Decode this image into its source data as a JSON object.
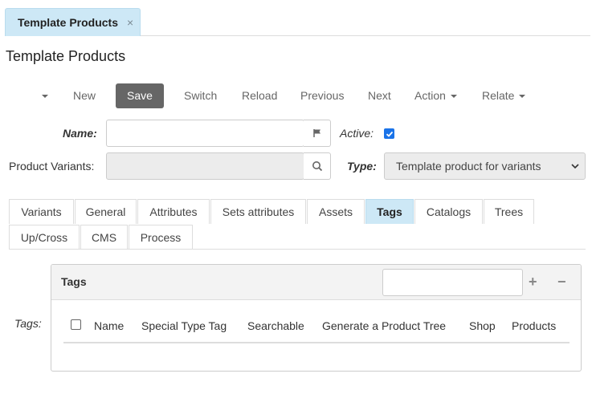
{
  "doc_tab": {
    "label": "Template Products",
    "close": "×"
  },
  "page_title": "Template Products",
  "toolbar": {
    "new": "New",
    "save": "Save",
    "switch": "Switch",
    "reload": "Reload",
    "previous": "Previous",
    "next": "Next",
    "action": "Action",
    "relate": "Relate"
  },
  "form": {
    "name_label": "Name:",
    "name_value": "",
    "active_label": "Active:",
    "active_checked": true,
    "variants_label": "Product Variants:",
    "variants_value": "",
    "type_label": "Type:",
    "type_value": "Template product for variants"
  },
  "tabs_row1": [
    "Variants",
    "General",
    "Attributes",
    "Sets attributes",
    "Assets",
    "Tags",
    "Catalogs",
    "Trees"
  ],
  "tabs_row2": [
    "Up/Cross",
    "CMS",
    "Process"
  ],
  "active_tab": "Tags",
  "tags": {
    "field_label": "Tags:",
    "panel_title": "Tags",
    "search_value": "",
    "add": "+",
    "remove": "−",
    "columns": [
      "Name",
      "Special Type Tag",
      "Searchable",
      "Generate a Product Tree",
      "Shop",
      "Products"
    ]
  },
  "colors": {
    "active_tab": "#cde8f6",
    "save_button": "#666666",
    "checkbox": "#1a73e8"
  }
}
